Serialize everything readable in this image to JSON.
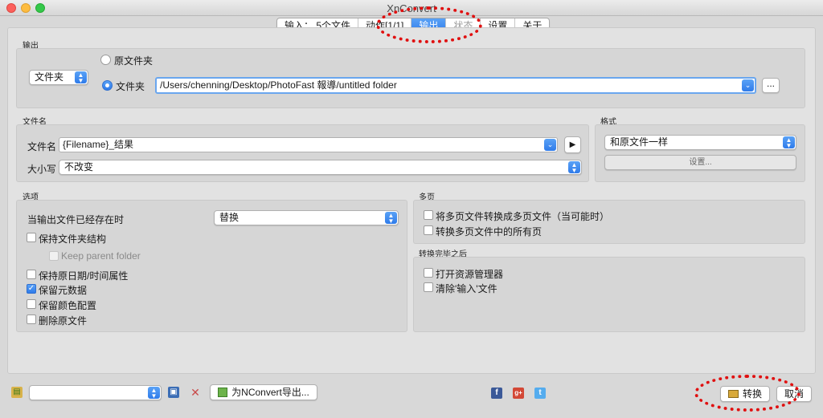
{
  "window": {
    "title": "XnConvert"
  },
  "tabs": [
    {
      "label": "输入： 5个文件",
      "state": "normal"
    },
    {
      "label": "动作[1/1]",
      "state": "normal"
    },
    {
      "label": "输出",
      "state": "active"
    },
    {
      "label": "状态",
      "state": "disabled"
    },
    {
      "label": "设置",
      "state": "normal"
    },
    {
      "label": "关于",
      "state": "normal"
    }
  ],
  "output": {
    "section_label": "输出",
    "destination_select": "文件夹",
    "radio_original_label": "原文件夹",
    "radio_folder_label": "文件夹",
    "folder_path": "/Users/chenning/Desktop/PhotoFast 報導/untitled folder",
    "browse_label": "..."
  },
  "filename": {
    "section_label": "文件名",
    "name_label": "文件名",
    "name_value": "{Filename}_结果",
    "case_label": "大小写",
    "case_value": "不改变"
  },
  "format": {
    "section_label": "格式",
    "format_value": "和原文件一样",
    "settings_label": "设置..."
  },
  "options": {
    "section_label": "选项",
    "exists_label": "当输出文件已经存在时",
    "exists_value": "替换",
    "keep_folder_structure": "保持文件夹结构",
    "keep_parent_folder": "Keep parent folder",
    "keep_date_time": "保持原日期/时间属性",
    "keep_metadata": "保留元数据",
    "keep_color_profile": "保留颜色配置",
    "delete_original": "删除原文件"
  },
  "multipage": {
    "section_label": "多页",
    "convert_multipage": "将多页文件转换成多页文件（当可能时）",
    "convert_all_pages": "转换多页文件中的所有页"
  },
  "after": {
    "section_label": "转换完毕之后",
    "open_explorer": "打开资源管理器",
    "clear_input": "清除'输入'文件"
  },
  "footer": {
    "preset_value": "",
    "export_label": "为NConvert导出...",
    "convert_label": "转换",
    "cancel_label": "取消",
    "social": [
      "f",
      "g+",
      "t"
    ]
  },
  "colors": {
    "accent": "#2f7bea",
    "annotation": "#e01010"
  }
}
